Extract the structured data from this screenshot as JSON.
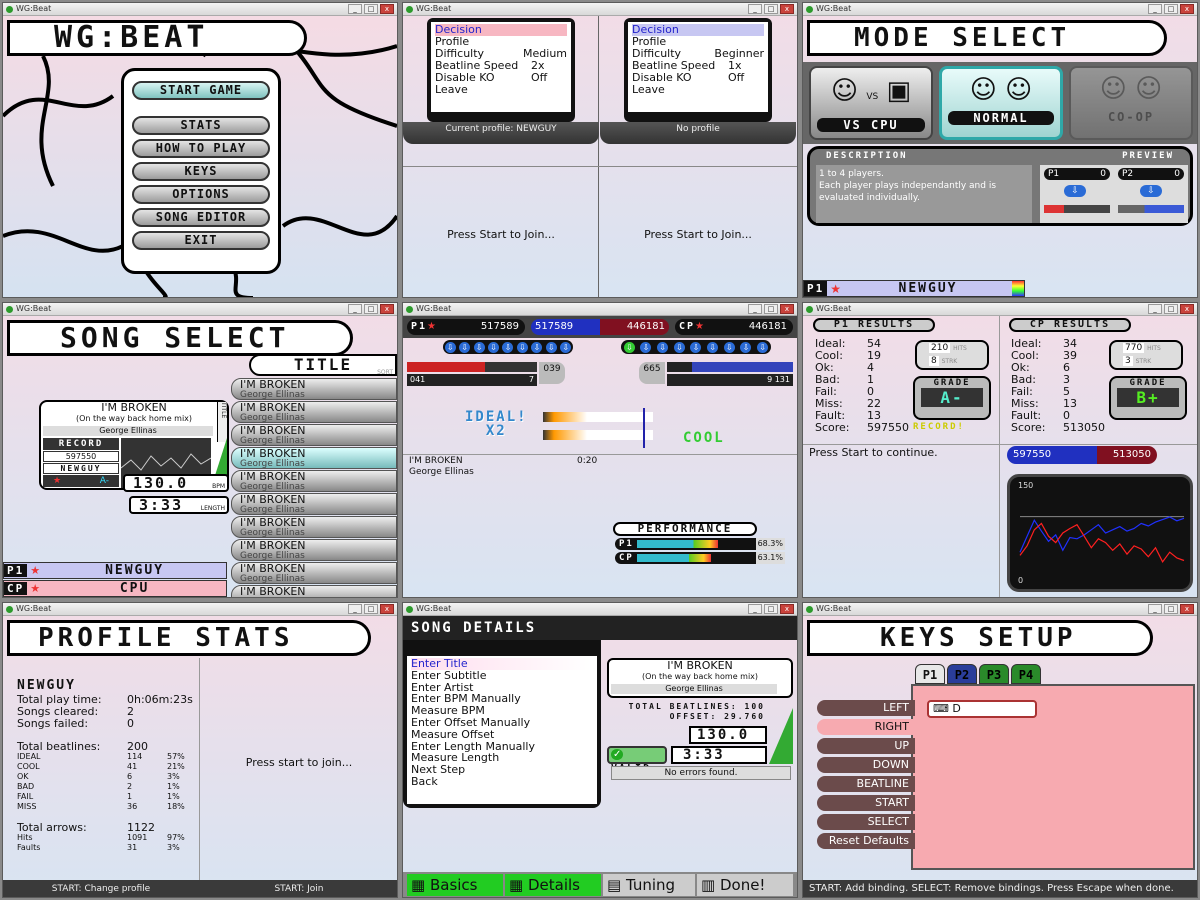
{
  "window_title": "WG:Beat",
  "main_menu": {
    "title": "WG:BEAT",
    "items": [
      "START GAME",
      "STATS",
      "HOW TO PLAY",
      "KEYS",
      "OPTIONS",
      "SONG EDITOR",
      "EXIT"
    ]
  },
  "join": {
    "left": {
      "menu": [
        [
          "Decision",
          ""
        ],
        [
          "Profile",
          ""
        ],
        [
          "Difficulty",
          "Medium"
        ],
        [
          "Beatline Speed",
          "2x"
        ],
        [
          "Disable KO",
          "Off"
        ],
        [
          "Leave",
          ""
        ]
      ],
      "profile": "Current profile: NEWGUY",
      "prompt": "Press Start to Join..."
    },
    "right": {
      "menu": [
        [
          "Decision",
          ""
        ],
        [
          "Profile",
          ""
        ],
        [
          "Difficulty",
          "Beginner"
        ],
        [
          "Beatline Speed",
          "1x"
        ],
        [
          "Disable KO",
          "Off"
        ],
        [
          "Leave",
          ""
        ]
      ],
      "profile": "No profile",
      "prompt": "Press Start to Join..."
    }
  },
  "mode_select": {
    "title": "MODE SELECT",
    "modes": [
      "VS CPU",
      "NORMAL",
      "CO-OP"
    ],
    "vs": "VS",
    "desc_label": "DESCRIPTION",
    "preview_label": "PREVIEW",
    "description": "1 to 4 players.\nEach player plays independantly and is evaluated individually.",
    "p1": "P1",
    "p2": "P2",
    "p1_score": "0",
    "p2_score": "0",
    "player": "NEWGUY"
  },
  "song_select": {
    "title": "SONG SELECT",
    "sort": "TITLE",
    "sort_tag": "SORT",
    "song_title": "I'M BROKEN",
    "song_subtitle": "(On the way back home mix)",
    "artist": "George Ellinas",
    "record_label": "RECORD",
    "record": "597550",
    "record_holder": "NEWGUY",
    "grade": "A-",
    "bpm": "130.0",
    "bpm_label": "BPM",
    "length": "3:33",
    "length_label": "LENGTH",
    "title_tag": "TITLE",
    "list_title": "I'M BROKEN",
    "list_artist": "George Ellinas",
    "p1": "P1",
    "p1_name": "NEWGUY",
    "cpu": "CP",
    "cpu_name": "CPU"
  },
  "gameplay": {
    "p1_score": "517589",
    "bar_left": "517589",
    "bar_right": "446181",
    "cpu_score": "446181",
    "p1_combo": "039",
    "p1_low": "041",
    "p1_hits": "7",
    "cpu_combo": "665",
    "cpu_low": "9",
    "cpu_total": "131",
    "judge1": "IDEAL!",
    "judge1b": "X2",
    "judge2": "COOL",
    "song": "I'M BROKEN",
    "artist": "George Ellinas",
    "time": "0:20",
    "perf_label": "PERFORMANCE",
    "p1_perf": "68.3%",
    "cpu_perf": "63.1%",
    "p1_perf_v": 0.683,
    "cpu_perf_v": 0.631
  },
  "results": {
    "left": {
      "label": "P1 RESULTS",
      "rows": [
        [
          "Ideal:",
          "54"
        ],
        [
          "Cool:",
          "19"
        ],
        [
          "Ok:",
          "4"
        ],
        [
          "Bad:",
          "1"
        ],
        [
          "Fail:",
          "0"
        ],
        [
          "Miss:",
          "22"
        ],
        [
          "Fault:",
          "13"
        ],
        [
          "Score:",
          "597550"
        ]
      ],
      "hits": "210",
      "streak": "8",
      "hits_label": "HITS",
      "streak_label": "STRK",
      "grade_label": "GRADE",
      "grade": "A-",
      "record": "RECORD!"
    },
    "right": {
      "label": "CP RESULTS",
      "rows": [
        [
          "Ideal:",
          "34"
        ],
        [
          "Cool:",
          "39"
        ],
        [
          "Ok:",
          "6"
        ],
        [
          "Bad:",
          "3"
        ],
        [
          "Fail:",
          "5"
        ],
        [
          "Miss:",
          "13"
        ],
        [
          "Fault:",
          "0"
        ],
        [
          "Score:",
          "513050"
        ]
      ],
      "hits": "770",
      "streak": "3",
      "hits_label": "HITS",
      "streak_label": "STRK",
      "grade_label": "GRADE",
      "grade": "B+"
    },
    "continue": "Press Start to continue.",
    "bar_left": "597550",
    "bar_right": "513050",
    "graph_top": "150",
    "graph_bottom": "0"
  },
  "profile_stats": {
    "title": "PROFILE STATS",
    "name": "NEWGUY",
    "basic": [
      [
        "Total play time:",
        "0h:06m:23s"
      ],
      [
        "Songs cleared:",
        "2"
      ],
      [
        "Songs failed:",
        "0"
      ]
    ],
    "beat_label": "Total beatlines:",
    "beat_total": "200",
    "beat_rows": [
      [
        "IDEAL",
        "114",
        "57%"
      ],
      [
        "COOL",
        "41",
        "21%"
      ],
      [
        "OK",
        "6",
        "3%"
      ],
      [
        "BAD",
        "2",
        "1%"
      ],
      [
        "FAIL",
        "1",
        "1%"
      ],
      [
        "MISS",
        "36",
        "18%"
      ]
    ],
    "arrow_label": "Total arrows:",
    "arrow_total": "1122",
    "arrow_rows": [
      [
        "Hits",
        "1091",
        "97%"
      ],
      [
        "Faults",
        "31",
        "3%"
      ]
    ],
    "join": "Press start to join...",
    "foot_left": "START: Change profile",
    "foot_right": "START: Join"
  },
  "song_details": {
    "title": "SONG DETAILS",
    "menu": [
      "Enter Title",
      "Enter Subtitle",
      "Enter Artist",
      "Enter BPM Manually",
      "Measure BPM",
      "Enter Offset Manually",
      "Measure Offset",
      "Enter Length Manually",
      "Measure Length",
      "Next Step",
      "Back"
    ],
    "song": "I'M BROKEN",
    "subtitle": "(On the way back home mix)",
    "artist": "George Ellinas",
    "beatlines": "TOTAL BEATLINES: 100",
    "offset": "OFFSET: 29.760",
    "bpm": "130.0",
    "length": "3:33",
    "valid": "VALID",
    "errors": "No errors found.",
    "tabs": [
      "Basics",
      "Details",
      "Tuning",
      "Done!"
    ]
  },
  "keys": {
    "title": "KEYS SETUP",
    "tabs": [
      "P1",
      "P2",
      "P3",
      "P4"
    ],
    "actions": [
      "LEFT",
      "RIGHT",
      "UP",
      "DOWN",
      "BEATLINE",
      "START",
      "SELECT",
      "Reset Defaults"
    ],
    "binding": "D",
    "status": "START: Add binding. SELECT: Remove bindings. Press Escape when done."
  },
  "colors": {
    "p1": "#ff4040",
    "p2": "#2040ff",
    "accent": "#2fa8a8"
  },
  "chart_data": {
    "type": "line",
    "series": [
      {
        "name": "P1",
        "values": [
          45,
          70,
          95,
          78,
          62,
          72,
          48,
          68,
          66,
          72,
          80,
          88,
          75,
          80,
          85,
          78,
          82,
          90,
          86,
          92,
          96,
          100,
          94,
          98
        ]
      },
      {
        "name": "CP",
        "values": [
          40,
          55,
          80,
          90,
          70,
          60,
          75,
          82,
          88,
          70,
          52,
          66,
          60,
          48,
          58,
          42,
          55,
          50,
          38,
          52,
          30,
          45,
          36,
          32
        ]
      }
    ],
    "ylim": [
      0,
      150
    ]
  }
}
